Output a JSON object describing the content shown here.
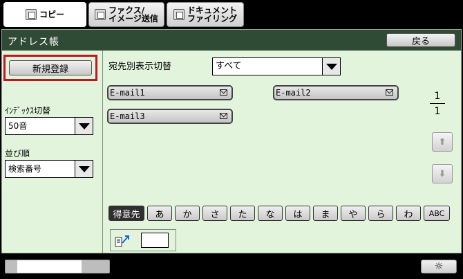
{
  "mode_tabs": [
    {
      "label": "コピー",
      "icon": "copy-icon",
      "active": true
    },
    {
      "label": "ファクス/\nイメージ送信",
      "icon": "fax-icon",
      "active": false
    },
    {
      "label": "ドキュメント\nファイリング",
      "icon": "document-filing-icon",
      "active": false
    }
  ],
  "address_book": {
    "title": "アドレス帳",
    "back_label": "戻る",
    "new_register_label": "新規登録",
    "display_switch_label": "宛先別表示切替",
    "display_switch_value": "すべて",
    "index_switch_label": "ｲﾝﾃﾞｯｸｽ切替",
    "index_switch_value": "50音",
    "sort_label": "並び順",
    "sort_value": "検索番号",
    "destinations": [
      "E-mail1",
      "E-mail2",
      "E-mail3"
    ],
    "page_current": "1",
    "page_total": "1",
    "index_tabs": [
      "得意先",
      "あ",
      "か",
      "さ",
      "た",
      "な",
      "は",
      "ま",
      "や",
      "ら",
      "わ",
      "ABC"
    ],
    "search_value": ""
  },
  "bottom": {
    "progress_fraction": 0.78,
    "brightness_icon": "sun-icon"
  },
  "colors": {
    "panel_bg": "#e2f4dc",
    "titlebar_bg": "#2f4a35",
    "highlight": "#c01820"
  }
}
